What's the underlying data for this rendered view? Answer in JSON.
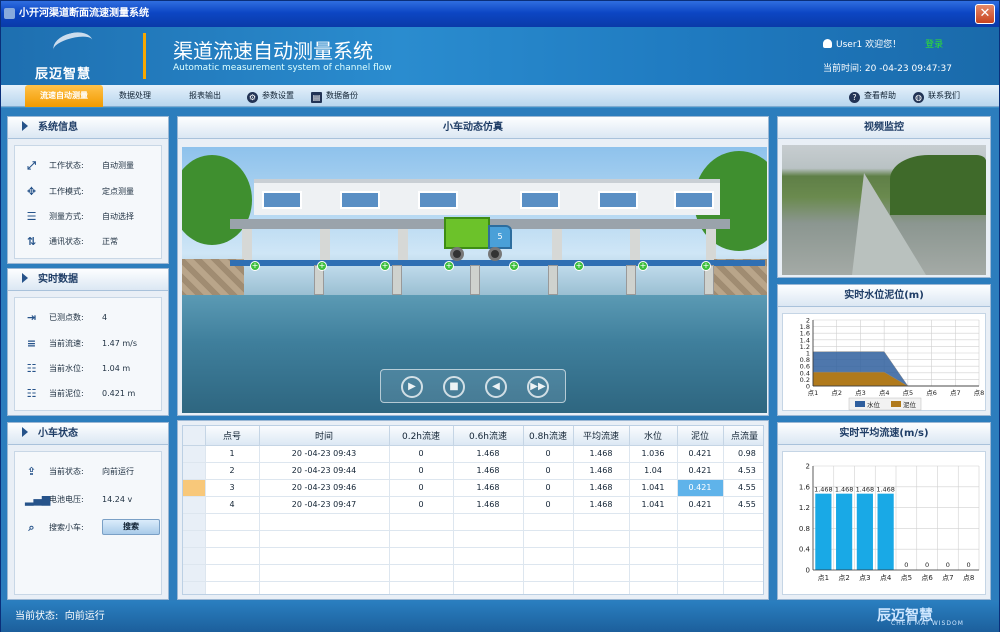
{
  "window": {
    "title": "小开河渠道断面流速测量系统",
    "close_glyph": "✕"
  },
  "banner": {
    "logo_text": "辰迈智慧",
    "title": "渠道流速自动测量系统",
    "subtitle": "Automatic measurement system of channel flow",
    "user_greeting": "User1 欢迎您！",
    "login": "登录",
    "time_label": "当前时间:",
    "time_value": "20 -04-23 09:47:37"
  },
  "menu": {
    "items": [
      {
        "label": "流速自动测量",
        "active": true
      },
      {
        "label": "数据处理"
      },
      {
        "label": "报表输出"
      },
      {
        "label": "参数设置",
        "icon": "gear-icon"
      },
      {
        "label": "数据备份",
        "icon": "backup-icon"
      }
    ],
    "help": "查看帮助",
    "contact": "联系我们"
  },
  "system_info": {
    "title": "系统信息",
    "rows": [
      {
        "label": "工作状态:",
        "value": "自动测量",
        "icon": "expand-icon"
      },
      {
        "label": "工作模式:",
        "value": "定点测量",
        "icon": "crosshair-icon"
      },
      {
        "label": "测量方式:",
        "value": "自动选择",
        "icon": "list-icon"
      },
      {
        "label": "通讯状态:",
        "value": "正常",
        "icon": "sync-icon"
      }
    ]
  },
  "realtime": {
    "title": "实时数据",
    "rows": [
      {
        "label": "已测点数:",
        "value": "4",
        "icon": "enter-icon"
      },
      {
        "label": "当前流速:",
        "value": "1.47 m/s",
        "icon": "align-icon"
      },
      {
        "label": "当前水位:",
        "value": "1.04 m",
        "icon": "level-icon"
      },
      {
        "label": "当前泥位:",
        "value": "0.421 m",
        "icon": "level-icon"
      }
    ]
  },
  "car_status": {
    "title": "小车状态",
    "rows": [
      {
        "label": "当前状态:",
        "value": "向前运行",
        "icon": "upload-icon"
      },
      {
        "label": "电池电压:",
        "value": "14.24 v",
        "icon": "signal-icon"
      },
      {
        "label": "搜索小车:",
        "icon": "search-icon"
      }
    ],
    "search_button": "搜索"
  },
  "simulation": {
    "title": "小车动态仿真",
    "truck_number": "5"
  },
  "video": {
    "title": "视频监控"
  },
  "water_chart": {
    "title": "实时水位泥位(m)"
  },
  "speed_chart": {
    "title": "实时平均流速(m/s)"
  },
  "table": {
    "headers": [
      "点号",
      "时间",
      "0.2h流速",
      "0.6h流速",
      "0.8h流速",
      "平均流速",
      "水位",
      "泥位"
    ],
    "rows": [
      [
        "1",
        "20 -04-23 09:43",
        "0",
        "1.468",
        "0",
        "1.468",
        "1.036",
        "0.421"
      ],
      [
        "2",
        "20 -04-23 09:44",
        "0",
        "1.468",
        "0",
        "1.468",
        "1.04",
        "0.421"
      ],
      [
        "3",
        "20 -04-23 09:46",
        "0",
        "1.468",
        "0",
        "1.468",
        "1.041",
        "0.421"
      ],
      [
        "4",
        "20 -04-23 09:47",
        "0",
        "1.468",
        "0",
        "1.468",
        "1.041",
        "0.421"
      ]
    ],
    "flow_header": "点流量",
    "flow_values": [
      "0.98",
      "4.53",
      "4.55",
      "4.55"
    ]
  },
  "statusbar": {
    "label": "当前状态:",
    "value": "向前运行",
    "brand": "辰迈智慧",
    "brand_en": "CHEN MAI WISDOM"
  },
  "chart_data": [
    {
      "type": "area",
      "title": "实时水位泥位(m)",
      "categories": [
        "点1",
        "点2",
        "点3",
        "点4",
        "点5",
        "点6",
        "点7",
        "点8"
      ],
      "series": [
        {
          "name": "水位",
          "values": [
            1.036,
            1.04,
            1.041,
            1.041,
            0,
            0,
            0,
            0
          ],
          "color": "#2f5f9e"
        },
        {
          "name": "泥位",
          "values": [
            0.421,
            0.421,
            0.421,
            0.421,
            0,
            0,
            0,
            0
          ],
          "color": "#b07a1c"
        }
      ],
      "ylim": [
        0,
        2
      ],
      "yticks": [
        "0",
        "0.2",
        "0.4",
        "0.6",
        "0.8",
        "1",
        "1.2",
        "1.4",
        "1.6",
        "1.8",
        "2"
      ],
      "grid": true,
      "legend": "bottom"
    },
    {
      "type": "bar",
      "title": "实时平均流速(m/s)",
      "categories": [
        "点1",
        "点2",
        "点3",
        "点4",
        "点5",
        "点6",
        "点7",
        "点8"
      ],
      "values": [
        1.468,
        1.468,
        1.468,
        1.468,
        0,
        0,
        0,
        0
      ],
      "labels": [
        "1.468",
        "1.468",
        "1.468",
        "1.468",
        "0",
        "0",
        "0",
        "0"
      ],
      "ylim": [
        0,
        2
      ],
      "yticks": [
        "0",
        "0.4",
        "0.8",
        "1.2",
        "1.6",
        "2"
      ],
      "color": "#19a9e6",
      "grid": true
    }
  ]
}
